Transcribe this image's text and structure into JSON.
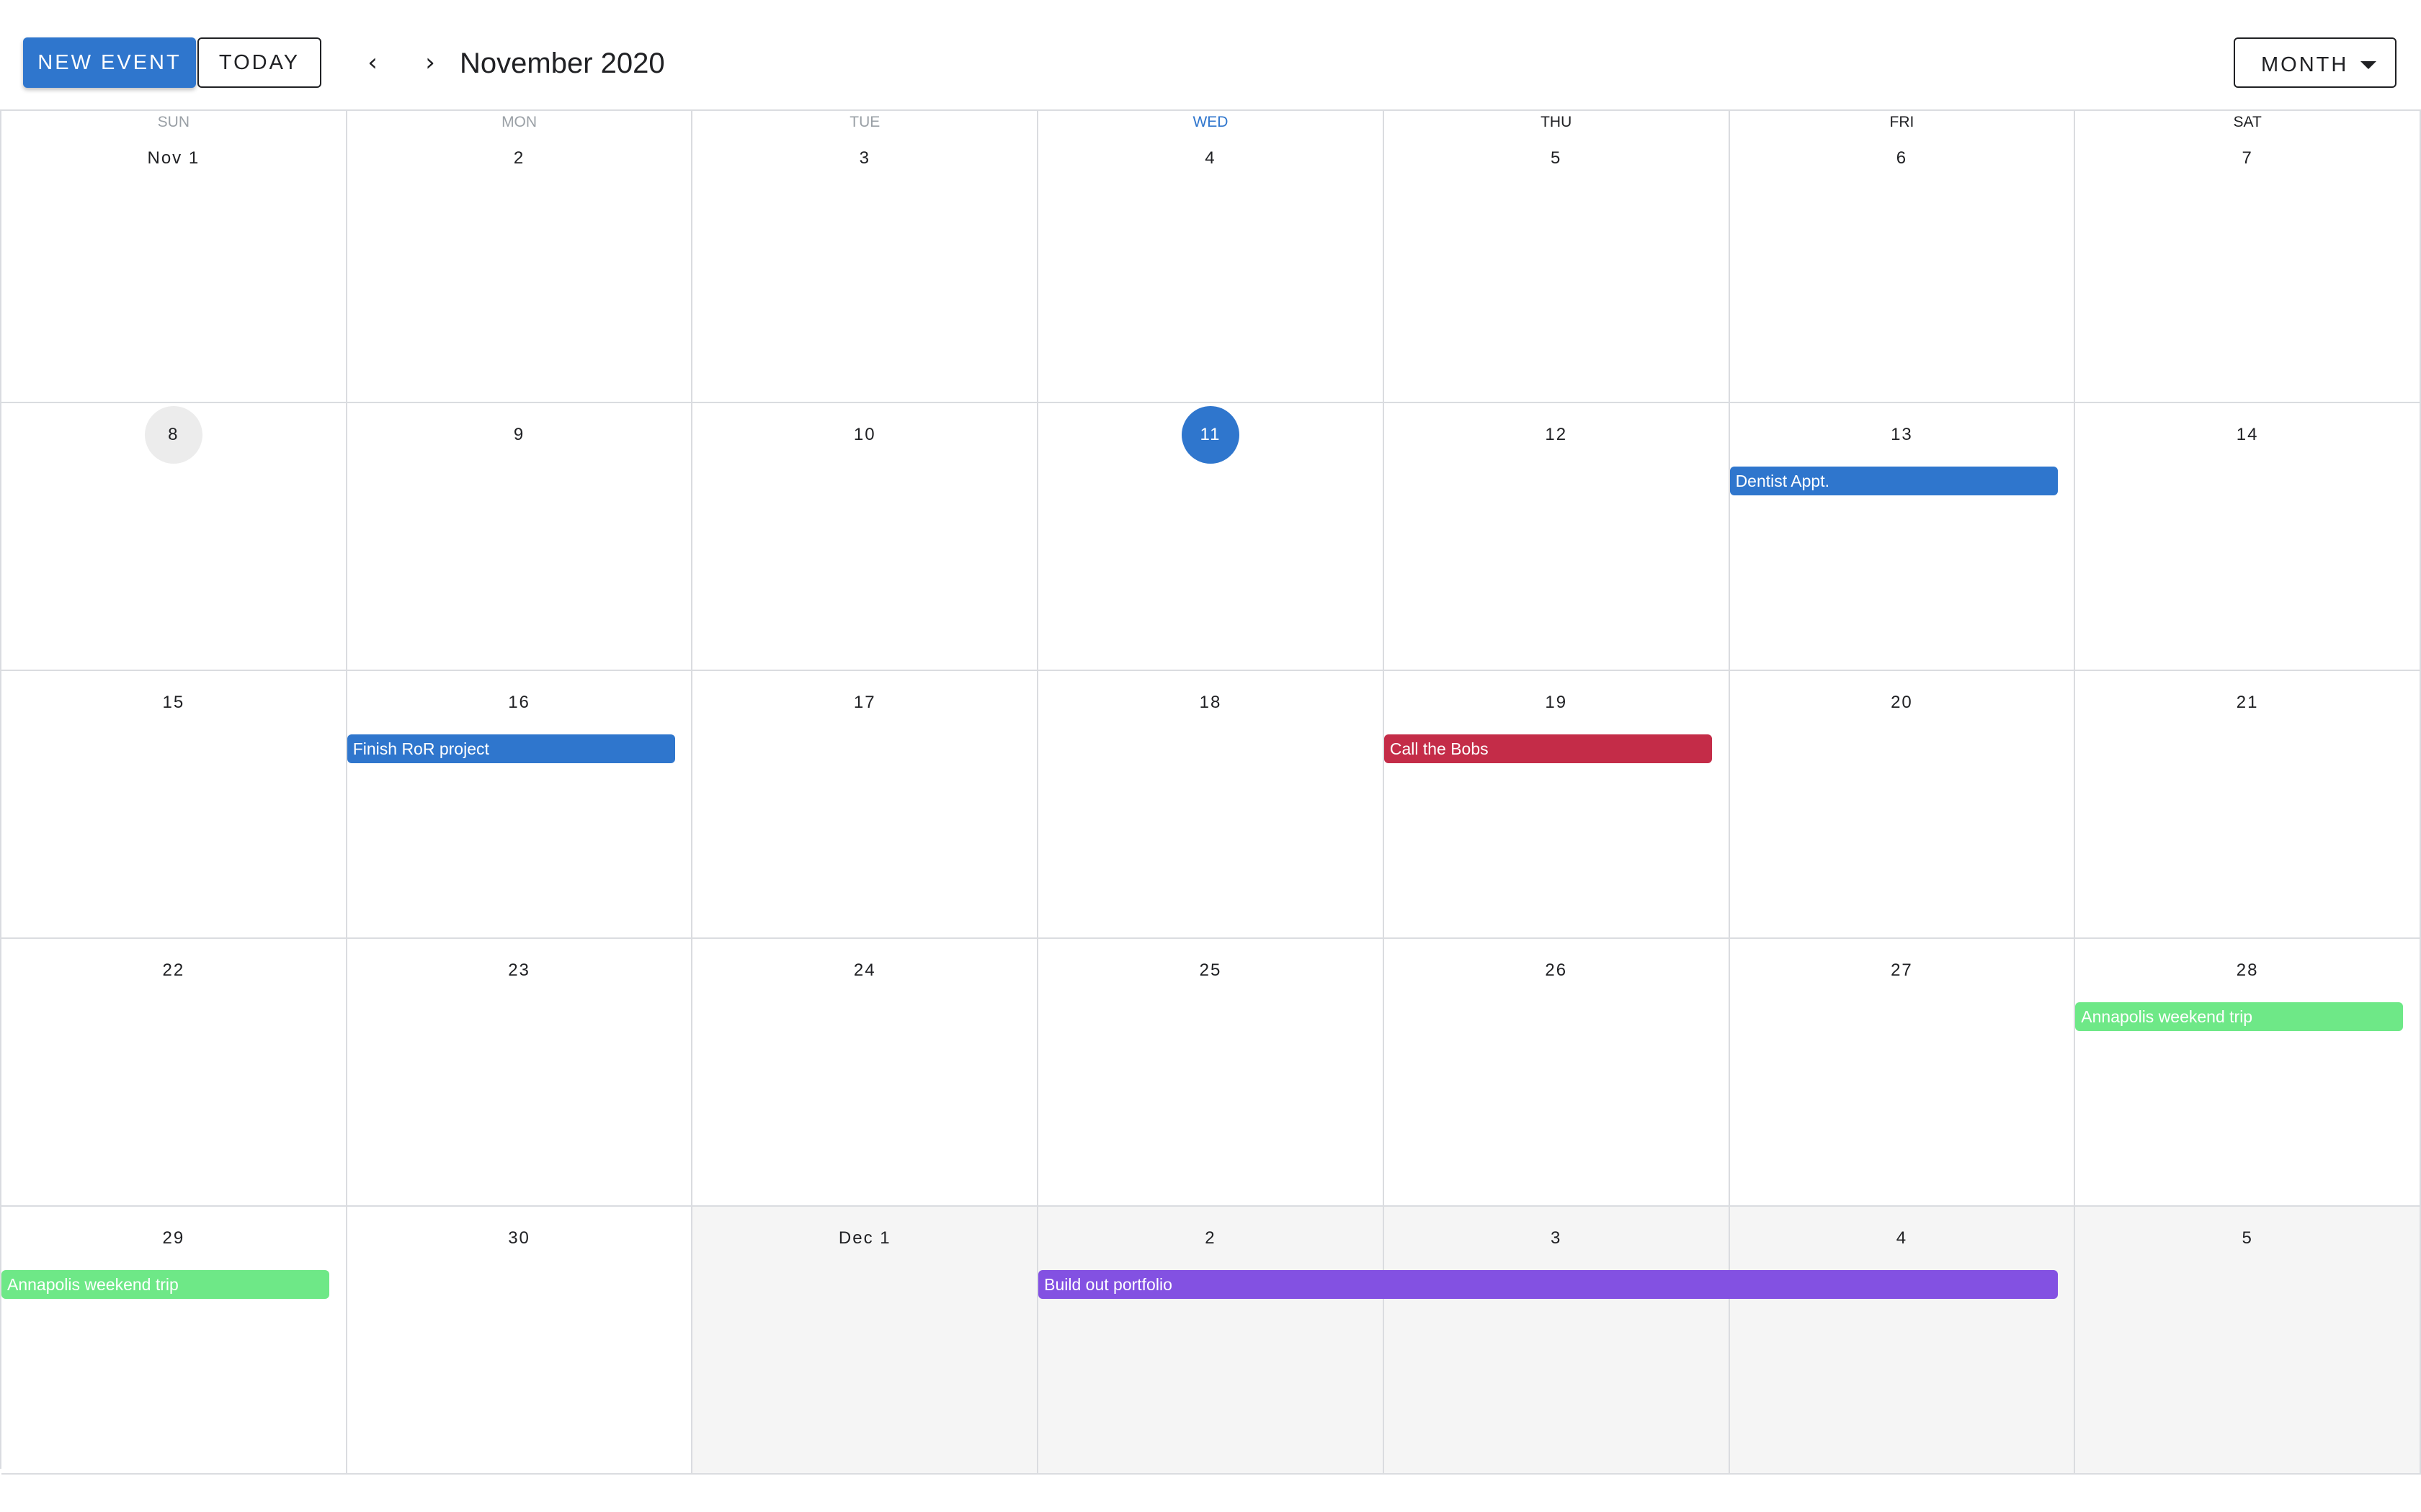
{
  "toolbar": {
    "new_event_label": "NEW EVENT",
    "today_label": "TODAY",
    "prev_icon": "‹",
    "next_icon": "›",
    "month_title": "November 2020",
    "view_label": "MONTH"
  },
  "weekdays": [
    "SUN",
    "MON",
    "TUE",
    "WED",
    "THU",
    "FRI",
    "SAT"
  ],
  "weeks": [
    [
      "Nov 1",
      "2",
      "3",
      "4",
      "5",
      "6",
      "7"
    ],
    [
      "8",
      "9",
      "10",
      "11",
      "12",
      "13",
      "14"
    ],
    [
      "15",
      "16",
      "17",
      "18",
      "19",
      "20",
      "21"
    ],
    [
      "22",
      "23",
      "24",
      "25",
      "26",
      "27",
      "28"
    ],
    [
      "29",
      "30",
      "Dec 1",
      "2",
      "3",
      "4",
      "5"
    ]
  ],
  "events": {
    "dentist": "Dentist Appt.",
    "ror": "Finish RoR project",
    "bobs": "Call the Bobs",
    "annapolis_sat": "Annapolis weekend trip",
    "annapolis_sun": "Annapolis weekend trip",
    "portfolio": "Build out portfolio"
  },
  "colors": {
    "primary": "#2f76cd",
    "event_blue": "#2f76cd",
    "event_red": "#c42c48",
    "event_green": "#6ee887",
    "event_purple": "#8351e2"
  }
}
